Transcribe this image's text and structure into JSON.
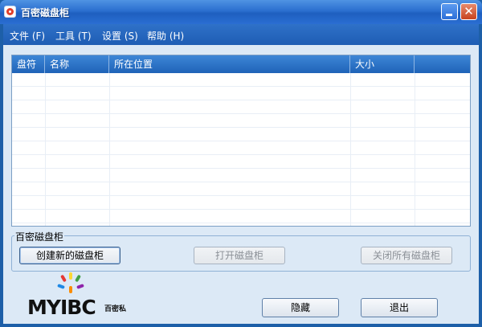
{
  "window": {
    "title": "百密磁盘柜",
    "minimize_glyph": "",
    "close_glyph": "✕"
  },
  "menu": [
    {
      "label": "文件 (F)"
    },
    {
      "label": "工具 (T)"
    },
    {
      "label": "设置 (S)"
    },
    {
      "label": "帮助 (H)"
    }
  ],
  "drive_list": {
    "columns": [
      "盘符",
      "名称",
      "所在位置",
      "大小",
      ""
    ],
    "rows": []
  },
  "group": {
    "title": "百密磁盘柜",
    "buttons": [
      {
        "label": "创建新的磁盘柜",
        "enabled": true
      },
      {
        "label": "打开磁盘柜",
        "enabled": false
      },
      {
        "label": "关闭所有磁盘柜",
        "enabled": false
      }
    ]
  },
  "logo": {
    "text": "MYIBC",
    "subtitle": "百密私",
    "petal_colors": [
      "#e53935",
      "#fdd835",
      "#43a047",
      "#1e88e5",
      "#8e24aa",
      "#fb8c00"
    ]
  },
  "footer": {
    "hide_label": "隐藏",
    "exit_label": "退出"
  },
  "colors": {
    "titlebar": "#2b6fcf",
    "menubar": "#1e5db4",
    "client_bg": "#dce9f6",
    "close_button": "#c8431f"
  }
}
